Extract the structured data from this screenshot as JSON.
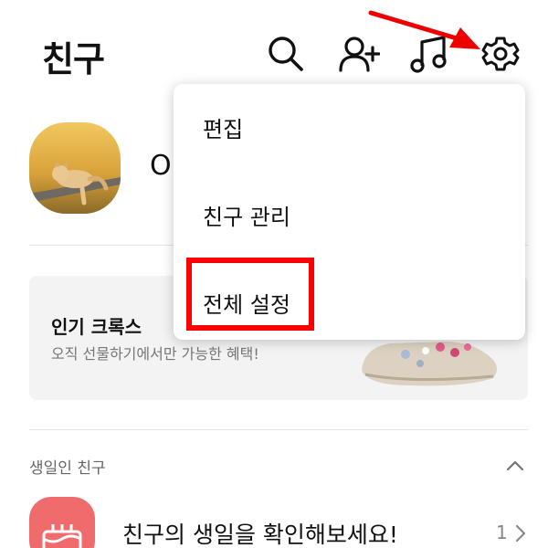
{
  "header": {
    "title": "친구",
    "icons": [
      "search-icon",
      "add-friend-icon",
      "music-icon",
      "settings-icon"
    ]
  },
  "profile": {
    "name_partial": "O",
    "avatar": "cat-on-log-photo"
  },
  "banner": {
    "title": "인기 크록스 ",
    "subtitle": "오직 선물하기에서만 가능한 혜택!",
    "image": "crocs-shoe-image"
  },
  "birthday_section": {
    "label": "생일인 친구",
    "row_text": "친구의 생일을 확인해보세요!",
    "count": "1"
  },
  "menu": {
    "items": [
      {
        "label": "편집"
      },
      {
        "label": "친구 관리"
      },
      {
        "label": "전체 설정"
      }
    ],
    "highlighted": "전체 설정"
  },
  "colors": {
    "highlight_box": "#ff0000",
    "annotation_arrow": "#ee0000",
    "birthday_icon_bg": "#f06b6b",
    "banner_bg": "#f3f3f3"
  }
}
